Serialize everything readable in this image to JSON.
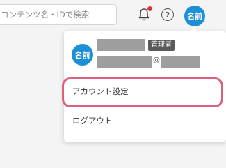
{
  "header": {
    "search_placeholder": "コンテンツ名・IDで検索",
    "help_symbol": "?",
    "avatar_initials": "名前",
    "notification_dot_color": "#e0333b"
  },
  "user_menu": {
    "avatar_initials": "名前",
    "role_badge": "管理者",
    "email_at": "@",
    "items": [
      {
        "label": "アカウント設定"
      },
      {
        "label": "ログアウト"
      }
    ]
  },
  "colors": {
    "accent": "#1d8fd6",
    "highlight_outline": "#dc5f7d"
  }
}
